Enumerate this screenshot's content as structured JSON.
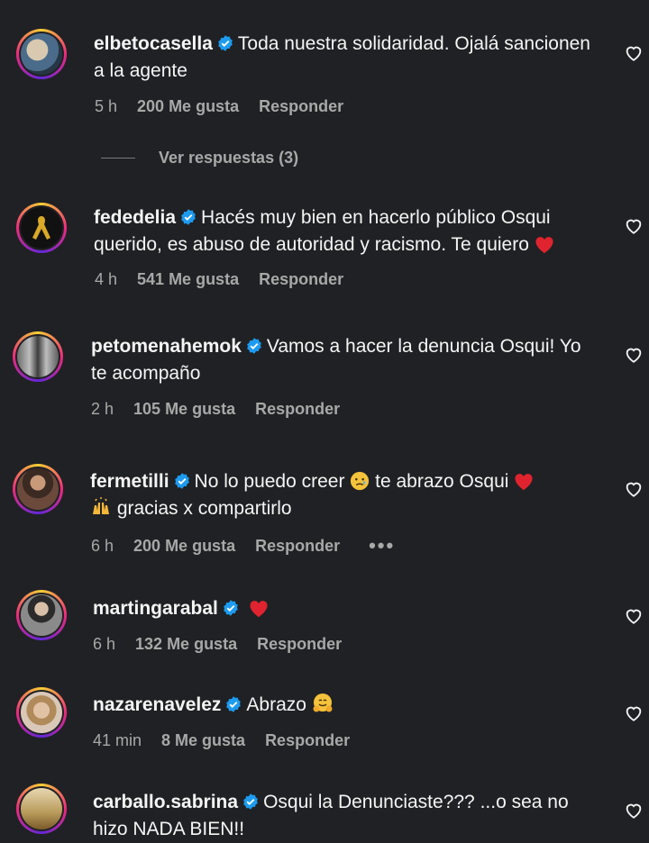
{
  "comments": [
    {
      "username": "elbetocasella",
      "text": "Toda nuestra solidaridad. Ojalá sancionen a la agente",
      "time": "5 h",
      "likes": "200 Me gusta",
      "reply": "Responder"
    },
    {
      "username": "fededelia",
      "text": "Hacés muy bien en hacerlo público Osqui querido, es abuso de autoridad y racismo. Te quiero",
      "time": "4 h",
      "likes": "541 Me gusta",
      "reply": "Responder"
    },
    {
      "username": "petomenahemok",
      "text": "Vamos a hacer la denuncia Osqui! Yo te acompaño",
      "time": "2 h",
      "likes": "105 Me gusta",
      "reply": "Responder"
    },
    {
      "username": "fermetilli",
      "text_a": "No lo puedo creer",
      "text_b": "te abrazo Osqui",
      "text_c": "gracias x compartirlo",
      "time": "6 h",
      "likes": "200 Me gusta",
      "reply": "Responder",
      "more": "•••"
    },
    {
      "username": "martingarabal",
      "time": "6 h",
      "likes": "132 Me gusta",
      "reply": "Responder"
    },
    {
      "username": "nazarenavelez",
      "text": "Abrazo",
      "time": "41 min",
      "likes": "8 Me gusta",
      "reply": "Responder"
    },
    {
      "username": "carballo.sabrina",
      "text": "Osqui la Denunciaste??? ...o sea no hizo NADA BIEN!!"
    }
  ],
  "view_replies": "Ver respuestas (3)",
  "colors": {
    "background": "#202124",
    "text": "#f5f5f5",
    "muted": "#a8a8a8",
    "verified": "#1d9bf0",
    "heart_red": "#e0242f"
  },
  "icons": [
    "verified-badge-icon",
    "heart-outline-icon",
    "red-heart-emoji",
    "crying-face-emoji",
    "raised-hands-emoji",
    "hugging-face-emoji"
  ]
}
